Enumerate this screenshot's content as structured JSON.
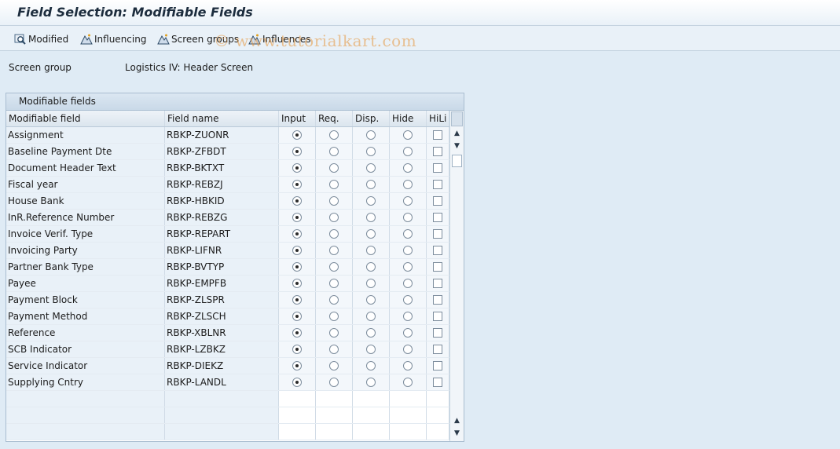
{
  "window": {
    "title": "Field Selection: Modifiable Fields"
  },
  "toolbar": {
    "buttons": [
      {
        "label": "Modified",
        "icon": "magnifier-icon"
      },
      {
        "label": "Influencing",
        "icon": "mountain-icon"
      },
      {
        "label": "Screen groups",
        "icon": "mountain-icon"
      },
      {
        "label": "Influences",
        "icon": "mountain-icon"
      }
    ]
  },
  "watermark": "© www.tutorialkart.com",
  "screen_group": {
    "label": "Screen group",
    "value": "Logistics IV: Header Screen"
  },
  "panel": {
    "title": "Modifiable fields"
  },
  "table": {
    "columns": [
      "Modifiable field",
      "Field name",
      "Input",
      "Req.",
      "Disp.",
      "Hide",
      "HiLi"
    ],
    "rows": [
      {
        "field": "Assignment",
        "name": "RBKP-ZUONR",
        "selected": "Input",
        "hili": false
      },
      {
        "field": "Baseline Payment Dte",
        "name": "RBKP-ZFBDT",
        "selected": "Input",
        "hili": false
      },
      {
        "field": "Document Header Text",
        "name": "RBKP-BKTXT",
        "selected": "Input",
        "hili": false
      },
      {
        "field": "Fiscal year",
        "name": "RBKP-REBZJ",
        "selected": "Input",
        "hili": false
      },
      {
        "field": "House Bank",
        "name": "RBKP-HBKID",
        "selected": "Input",
        "hili": false
      },
      {
        "field": "InR.Reference Number",
        "name": "RBKP-REBZG",
        "selected": "Input",
        "hili": false
      },
      {
        "field": "Invoice Verif. Type",
        "name": "RBKP-REPART",
        "selected": "Input",
        "hili": false
      },
      {
        "field": "Invoicing Party",
        "name": "RBKP-LIFNR",
        "selected": "Input",
        "hili": false
      },
      {
        "field": "Partner Bank Type",
        "name": "RBKP-BVTYP",
        "selected": "Input",
        "hili": false
      },
      {
        "field": "Payee",
        "name": "RBKP-EMPFB",
        "selected": "Input",
        "hili": false
      },
      {
        "field": "Payment Block",
        "name": "RBKP-ZLSPR",
        "selected": "Input",
        "hili": false
      },
      {
        "field": "Payment Method",
        "name": "RBKP-ZLSCH",
        "selected": "Input",
        "hili": false
      },
      {
        "field": "Reference",
        "name": "RBKP-XBLNR",
        "selected": "Input",
        "hili": false
      },
      {
        "field": "SCB Indicator",
        "name": "RBKP-LZBKZ",
        "selected": "Input",
        "hili": false
      },
      {
        "field": "Service Indicator",
        "name": "RBKP-DIEKZ",
        "selected": "Input",
        "hili": false
      },
      {
        "field": "Supplying Cntry",
        "name": "RBKP-LANDL",
        "selected": "Input",
        "hili": false
      }
    ]
  },
  "colors": {
    "background": "#dfebf5",
    "header_bg": "#ffffff",
    "grid_border": "#a9bdd0"
  }
}
